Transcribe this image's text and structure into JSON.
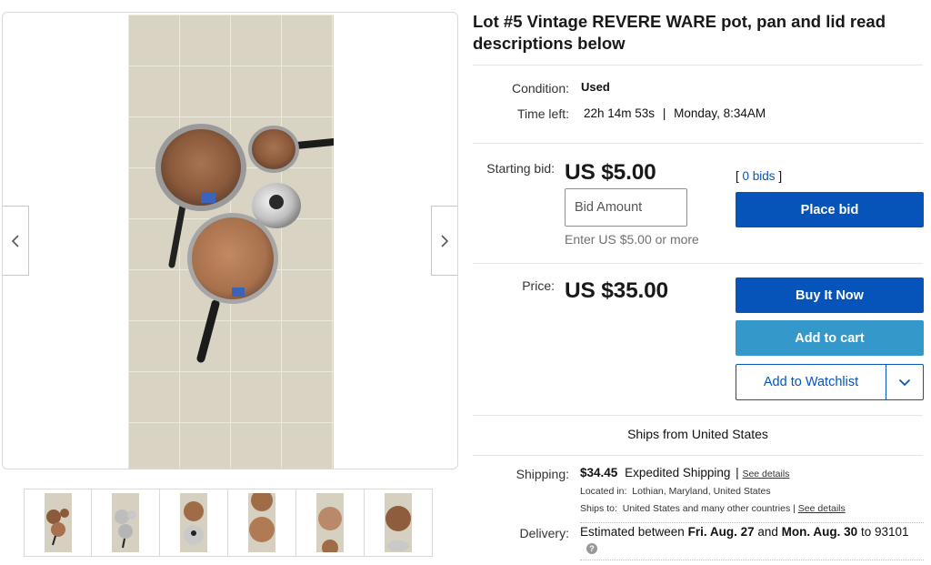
{
  "listing": {
    "title": "Lot #5 Vintage REVERE WARE pot, pan and lid read descriptions below"
  },
  "details": {
    "condition_label": "Condition:",
    "condition_value": "Used",
    "time_left_label": "Time left:",
    "time_left_value": "22h 14m 53s",
    "time_left_separator": "|",
    "time_left_end": "Monday, 8:34AM"
  },
  "bid": {
    "starting_bid_label": "Starting bid:",
    "starting_bid_value": "US $5.00",
    "bid_count_open": "[",
    "bid_count_link": "0 bids",
    "bid_count_close": "]",
    "input_placeholder": "Bid Amount",
    "hint": "Enter US $5.00 or more",
    "place_bid_label": "Place bid"
  },
  "buy": {
    "price_label": "Price:",
    "price_value": "US $35.00",
    "buy_now_label": "Buy It Now",
    "add_to_cart_label": "Add to cart",
    "watchlist_label": "Add to Watchlist"
  },
  "shipping": {
    "ships_from": "Ships from United States",
    "shipping_label": "Shipping:",
    "shipping_cost": "$34.45",
    "shipping_method": "Expedited Shipping",
    "sep": "|",
    "see_details": "See details",
    "located_in_label": "Located in:",
    "located_in_value": "Lothian, Maryland, United States",
    "ships_to_label": "Ships to:",
    "ships_to_value": "United States and many other countries",
    "ships_to_sep": "|",
    "ships_to_details": "See details",
    "delivery_label": "Delivery:",
    "delivery_prefix": "Estimated between",
    "delivery_start": "Fri. Aug. 27",
    "delivery_and": "and",
    "delivery_end": "Mon. Aug. 30",
    "delivery_to": "to 93101",
    "help_glyph": "?"
  },
  "gallery": {
    "thumbnail_count": 6,
    "icons": {
      "prev": "chevron-left-icon",
      "next": "chevron-right-icon",
      "caret": "chevron-down-icon"
    }
  },
  "colors": {
    "primary_button": "#0654ba",
    "secondary_button": "#3498ca",
    "link": "#0654ba",
    "tile_floor": "#d9d3c3",
    "copper": "#b07a55"
  }
}
